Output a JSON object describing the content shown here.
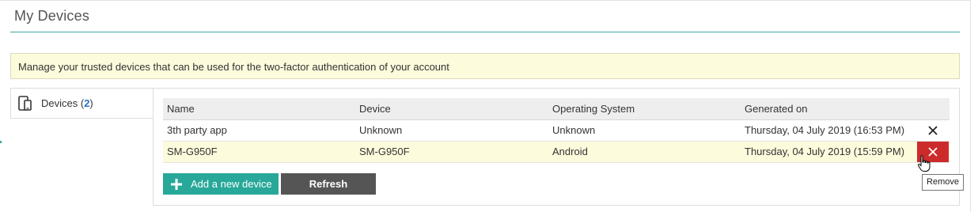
{
  "header": {
    "title": "My Devices"
  },
  "banner": {
    "text": "Manage your trusted devices that can be used for the two-factor authentication of your account"
  },
  "sidebar": {
    "tab_label": "Devices (",
    "tab_count": "2",
    "tab_close": ")",
    "tab_icon": "mobile-devices-icon"
  },
  "table": {
    "columns": [
      "Name",
      "Device",
      "Operating System",
      "Generated on"
    ],
    "rows": [
      {
        "name": "3th party app",
        "device": "Unknown",
        "os": "Unknown",
        "generated": "Thursday, 04 July 2019 (16:53 PM)"
      },
      {
        "name": "SM-G950F",
        "device": "SM-G950F",
        "os": "Android",
        "generated": "Thursday, 04 July 2019 (15:59 PM)"
      }
    ]
  },
  "actions": {
    "add_label": "Add a new device",
    "refresh_label": "Refresh"
  },
  "tooltip": {
    "text": "Remove"
  },
  "colors": {
    "accent": "#27a899",
    "danger": "#cc2b2b",
    "banner_bg": "#fcfbdc",
    "refresh_bg": "#555555"
  }
}
